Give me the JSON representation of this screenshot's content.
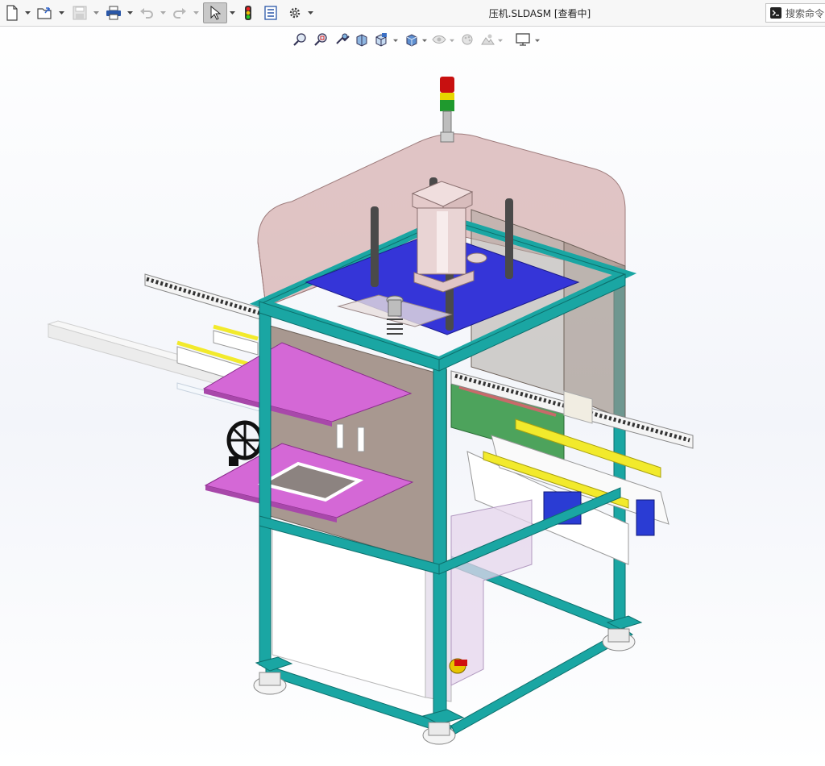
{
  "window": {
    "title": "压机.SLDASM [查看中]"
  },
  "search": {
    "label": "搜索命令"
  },
  "toolbar": {
    "items": [
      "new-document",
      "open",
      "save",
      "print",
      "undo",
      "redo",
      "select",
      "rebuild",
      "file-properties",
      "options"
    ]
  },
  "heads_up_toolbar": {
    "items": [
      "zoom-to-fit",
      "zoom-to-area",
      "previous-view",
      "section-view",
      "view-orientation",
      "display-style",
      "hide-show-items",
      "edit-appearance",
      "apply-scene",
      "view-settings"
    ]
  },
  "colors": {
    "frame_teal": "#1aa6a3",
    "enclosure_pink": "#d8b4b4",
    "top_plate_blue": "#3c3ce0",
    "magenta_plates": "#d468d6",
    "conveyor_yellow": "#f2ea2c",
    "motor_blue": "#2a3cd4",
    "signal_red": "#d01010"
  }
}
